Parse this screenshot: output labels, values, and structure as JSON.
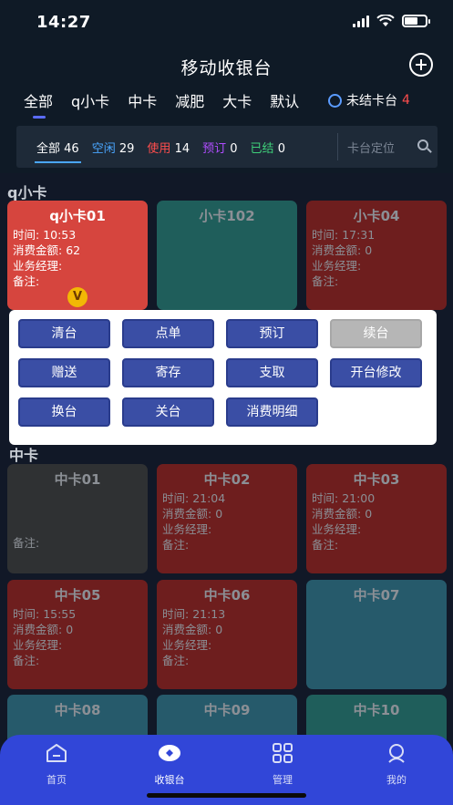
{
  "status": {
    "time": "14:27"
  },
  "header": {
    "title": "移动收银台"
  },
  "category_tabs": [
    "全部",
    "q小卡",
    "中卡",
    "减肥",
    "大卡",
    "默认"
  ],
  "unsettled": {
    "label": "未结卡台",
    "count": "4"
  },
  "filters": [
    {
      "label": "全部",
      "count": "46",
      "color": "#ffffff"
    },
    {
      "label": "空闲",
      "count": "29",
      "color": "#4aa6ff"
    },
    {
      "label": "使用",
      "count": "14",
      "color": "#ff4d4d"
    },
    {
      "label": "预订",
      "count": "0",
      "color": "#b04dff"
    },
    {
      "label": "已结",
      "count": "0",
      "color": "#3fd17a"
    }
  ],
  "locate_placeholder": "卡台定位",
  "sections": {
    "small": "q小卡",
    "medium": "中卡"
  },
  "labels": {
    "time": "时间: ",
    "amount": "消费金额: ",
    "manager": "业务经理:",
    "note": "备注:"
  },
  "cards": [
    {
      "name": "q小卡01",
      "time": "10:53",
      "amount": "62",
      "status": "active"
    },
    {
      "name": "小卡102",
      "status": "teal"
    },
    {
      "name": "小卡04",
      "time": "17:31",
      "amount": "0",
      "status": "red"
    },
    {
      "name": "中卡01",
      "status": "dark"
    },
    {
      "name": "中卡02",
      "time": "21:04",
      "amount": "0",
      "status": "red"
    },
    {
      "name": "中卡03",
      "time": "21:00",
      "amount": "0",
      "status": "red"
    },
    {
      "name": "中卡05",
      "time": "15:55",
      "amount": "0",
      "status": "red"
    },
    {
      "name": "中卡06",
      "time": "21:13",
      "amount": "0",
      "status": "red"
    },
    {
      "name": "中卡07",
      "status": "blue"
    },
    {
      "name": "中卡08",
      "status": "blue"
    },
    {
      "name": "中卡09",
      "status": "blue"
    },
    {
      "name": "中卡10",
      "status": "teal"
    }
  ],
  "vip_badge": "V",
  "popup_actions": [
    "清台",
    "点单",
    "预订",
    "续台",
    "赠送",
    "寄存",
    "支取",
    "开台修改",
    "换台",
    "关台",
    "消费明细"
  ],
  "bottom_nav": [
    "首页",
    "收银台",
    "管理",
    "我的"
  ],
  "colors": {
    "accent": "#3146d8",
    "active_card": "#d6453e",
    "danger": "#ff4d4d"
  }
}
